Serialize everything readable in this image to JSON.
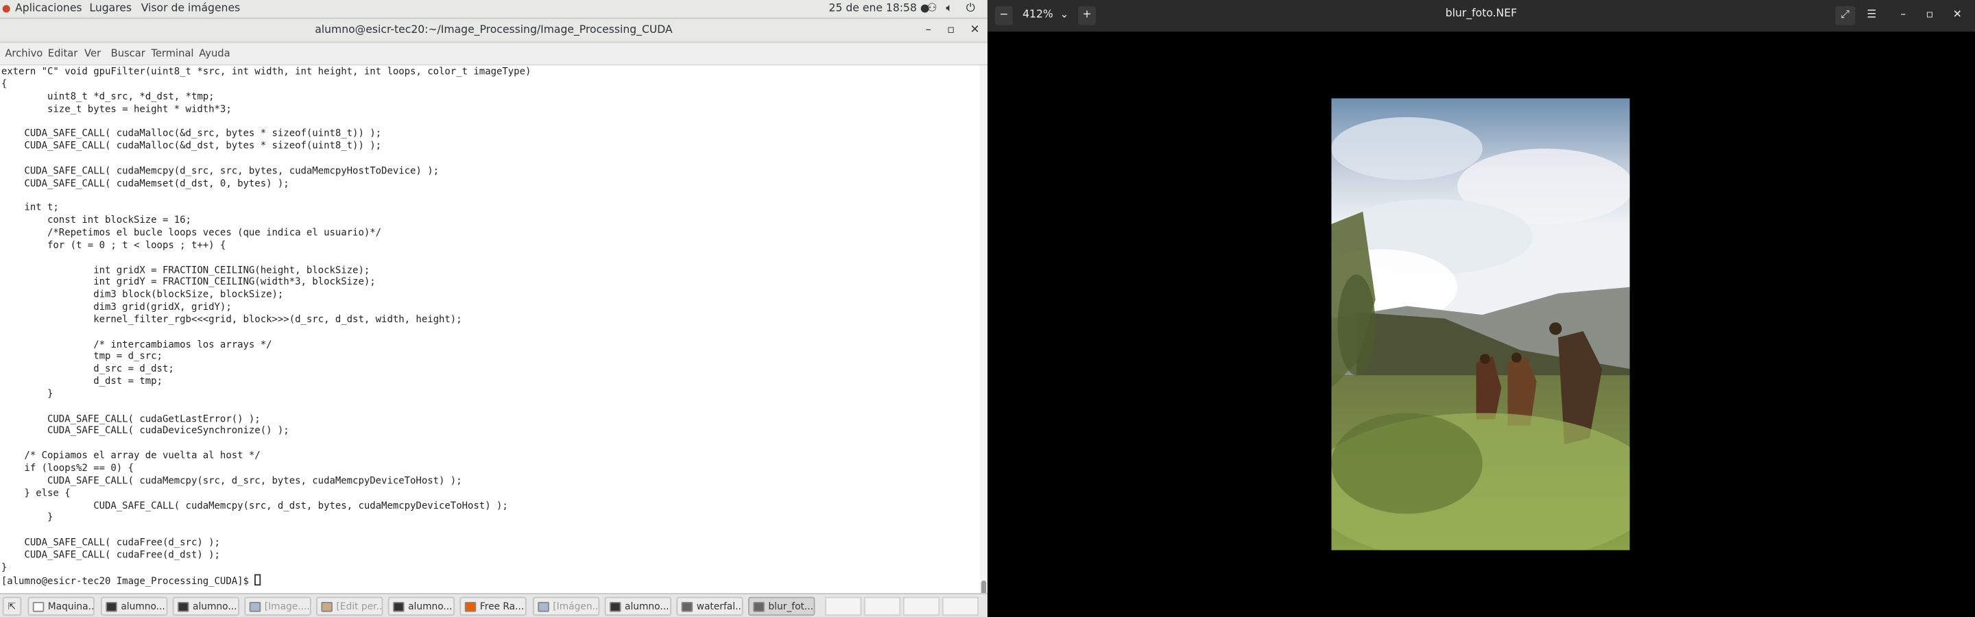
{
  "topbar": {
    "applications": "Aplicaciones",
    "places": "Lugares",
    "active_app": "Visor de imágenes",
    "clock": "25 de ene  18:58 ●",
    "network_icon": "network-icon",
    "volume_icon": "volume-icon",
    "power_icon": "power-icon"
  },
  "terminal": {
    "title": "alumno@esicr-tec20:~/Image_Processing/Image_Processing_CUDA",
    "minimize": "–",
    "maximize": "▫",
    "close": "✕",
    "menu": [
      "Archivo",
      "Editar",
      "Ver",
      "Buscar",
      "Terminal",
      "Ayuda"
    ],
    "code": "extern \"C\" void gpuFilter(uint8_t *src, int width, int height, int loops, color_t imageType)\n{\n        uint8_t *d_src, *d_dst, *tmp;\n        size_t bytes = height * width*3;\n\n    CUDA_SAFE_CALL( cudaMalloc(&d_src, bytes * sizeof(uint8_t)) );\n    CUDA_SAFE_CALL( cudaMalloc(&d_dst, bytes * sizeof(uint8_t)) );\n\n    CUDA_SAFE_CALL( cudaMemcpy(d_src, src, bytes, cudaMemcpyHostToDevice) );\n    CUDA_SAFE_CALL( cudaMemset(d_dst, 0, bytes) );\n\n    int t;\n        const int blockSize = 16;\n        /*Repetimos el bucle loops veces (que indica el usuario)*/\n        for (t = 0 ; t < loops ; t++) {\n\n                int gridX = FRACTION_CEILING(height, blockSize);\n                int gridY = FRACTION_CEILING(width*3, blockSize);\n                dim3 block(blockSize, blockSize);\n                dim3 grid(gridX, gridY);\n                kernel_filter_rgb<<<grid, block>>>(d_src, d_dst, width, height);\n\n                /* intercambiamos los arrays */\n                tmp = d_src;\n                d_src = d_dst;\n                d_dst = tmp;\n        }\n\n        CUDA_SAFE_CALL( cudaGetLastError() );\n        CUDA_SAFE_CALL( cudaDeviceSynchronize() );\n\n    /* Copiamos el array de vuelta al host */\n    if (loops%2 == 0) {\n        CUDA_SAFE_CALL( cudaMemcpy(src, d_src, bytes, cudaMemcpyDeviceToHost) );\n    } else {\n                CUDA_SAFE_CALL( cudaMemcpy(src, d_dst, bytes, cudaMemcpyDeviceToHost) );\n        }\n\n    CUDA_SAFE_CALL( cudaFree(d_src) );\n    CUDA_SAFE_CALL( cudaFree(d_dst) );\n}",
    "prompt": "[alumno@esicr-tec20 Image_Processing_CUDA]$ "
  },
  "taskbar": {
    "items": [
      {
        "label": "Maquina...",
        "icon": "document-icon",
        "color": "#ffffff"
      },
      {
        "label": "alumno...",
        "icon": "terminal-icon",
        "color": "#333333"
      },
      {
        "label": "alumno...",
        "icon": "terminal-icon",
        "color": "#333333"
      },
      {
        "label": "[Image....",
        "icon": "file-icon",
        "color": "#a9b7cf"
      },
      {
        "label": "[Edit per...",
        "icon": "gimp-icon",
        "color": "#c9a98a"
      },
      {
        "label": "alumno...",
        "icon": "terminal-icon",
        "color": "#333333"
      },
      {
        "label": "Free Ra...",
        "icon": "firefox-icon",
        "color": "#e66000"
      },
      {
        "label": "[Imágen...",
        "icon": "file-icon",
        "color": "#a9b7cf"
      },
      {
        "label": "alumno...",
        "icon": "terminal-icon",
        "color": "#333333"
      },
      {
        "label": "waterfal...",
        "icon": "image-viewer-icon",
        "color": "#666666"
      },
      {
        "label": "blur_fot...",
        "icon": "image-viewer-icon",
        "color": "#666666"
      }
    ]
  },
  "viewer": {
    "zoom": "412%",
    "title": "blur_foto.NEF"
  }
}
